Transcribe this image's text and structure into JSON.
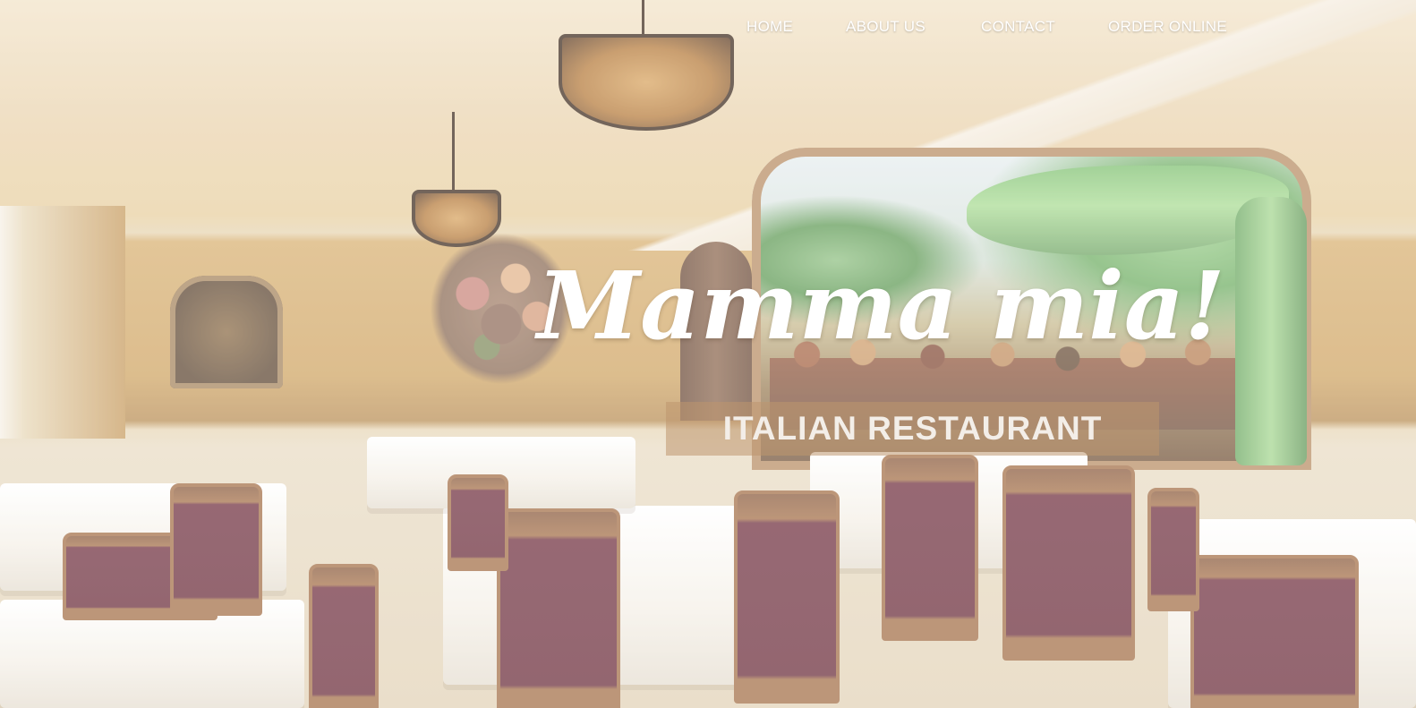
{
  "nav": {
    "items": [
      {
        "label": "HOME"
      },
      {
        "label": "ABOUT US"
      },
      {
        "label": "CONTACT"
      },
      {
        "label": "ORDER ONLINE"
      }
    ]
  },
  "hero": {
    "title": "Mamma mia!",
    "subtitle": "ITALIAN RESTAURANT",
    "background_image": "restaurant-dining-room-photo"
  },
  "colors": {
    "nav_text": "#ffffff",
    "title_text": "#ffffff",
    "subtitle_text": "#f3eee8",
    "subtitle_background": "#be966e"
  }
}
